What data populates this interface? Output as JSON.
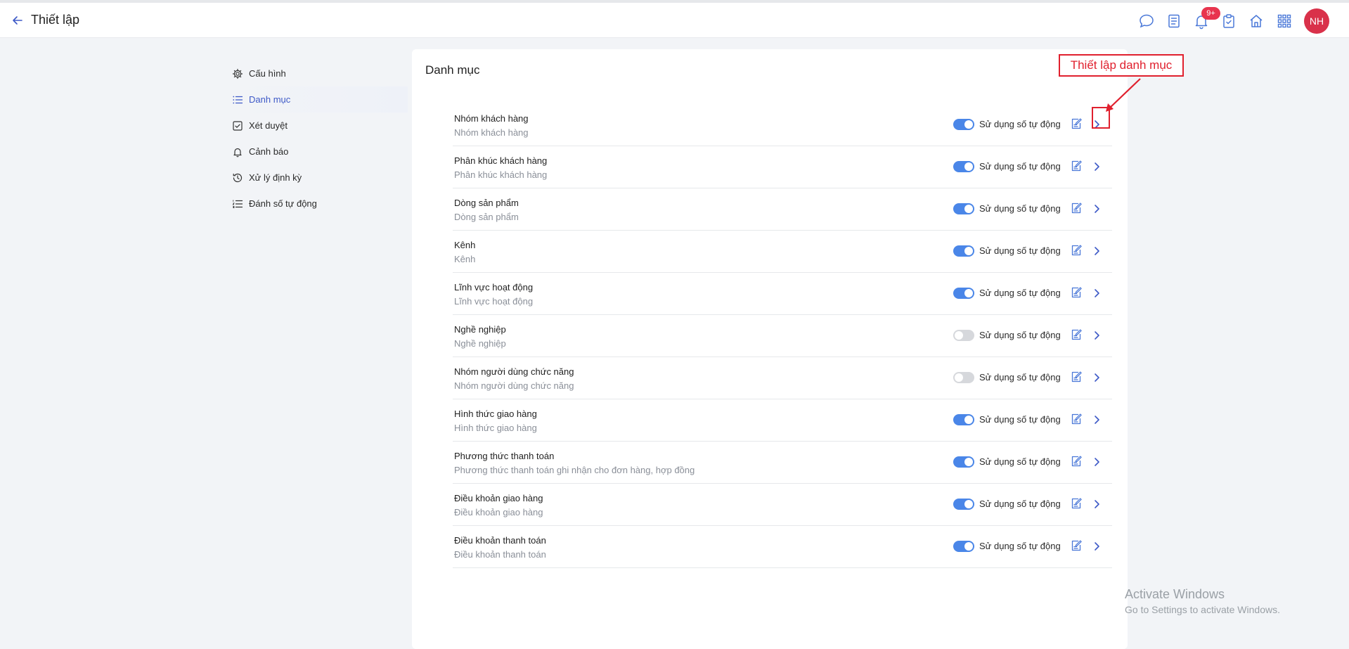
{
  "header": {
    "title": "Thiết lập",
    "notification_badge": "9+",
    "avatar_initials": "NH",
    "icons": [
      "chat-icon",
      "notes-icon",
      "bell-icon",
      "clipboard-icon",
      "home-icon",
      "apps-grid-icon"
    ]
  },
  "sidebar": {
    "items": [
      {
        "label": "Cấu hình",
        "icon": "gear-icon",
        "active": false
      },
      {
        "label": "Danh mục",
        "icon": "list-icon",
        "active": true
      },
      {
        "label": "Xét duyệt",
        "icon": "checkbox-icon",
        "active": false
      },
      {
        "label": "Cảnh báo",
        "icon": "bell-icon",
        "active": false
      },
      {
        "label": "Xử lý định kỳ",
        "icon": "history-icon",
        "active": false
      },
      {
        "label": "Đánh số tự động",
        "icon": "numbered-list-icon",
        "active": false
      }
    ]
  },
  "main": {
    "title": "Danh mục",
    "toggle_label": "Sử dụng số tự động",
    "rows": [
      {
        "name": "Nhóm khách hàng",
        "desc": "Nhóm khách hàng",
        "auto_number": true
      },
      {
        "name": "Phân khúc khách hàng",
        "desc": "Phân khúc khách hàng",
        "auto_number": true
      },
      {
        "name": "Dòng sản phẩm",
        "desc": "Dòng sản phẩm",
        "auto_number": true
      },
      {
        "name": "Kênh",
        "desc": "Kênh",
        "auto_number": true
      },
      {
        "name": "Lĩnh vực hoạt động",
        "desc": "Lĩnh vực hoạt động",
        "auto_number": true
      },
      {
        "name": "Nghề nghiệp",
        "desc": "Nghề nghiệp",
        "auto_number": false
      },
      {
        "name": "Nhóm người dùng chức năng",
        "desc": "Nhóm người dùng chức năng",
        "auto_number": false
      },
      {
        "name": "Hình thức giao hàng",
        "desc": "Hình thức giao hàng",
        "auto_number": true
      },
      {
        "name": "Phương thức thanh toán",
        "desc": "Phương thức thanh toán ghi nhận cho đơn hàng, hợp đồng",
        "auto_number": true
      },
      {
        "name": "Điều khoản giao hàng",
        "desc": "Điều khoản giao hàng",
        "auto_number": true
      },
      {
        "name": "Điều khoản thanh toán",
        "desc": "Điều khoản thanh toán",
        "auto_number": true
      }
    ]
  },
  "annotation": {
    "callout_text": "Thiết lập danh mục",
    "color": "#e0202e"
  },
  "watermark": {
    "title": "Activate Windows",
    "subtitle": "Go to Settings to activate Windows."
  },
  "colors": {
    "accent": "#3d59c7",
    "toggle_on": "#4a86e8",
    "toggle_off": "#d6d8dc",
    "badge": "#e8344e",
    "avatar": "#d9314a"
  }
}
